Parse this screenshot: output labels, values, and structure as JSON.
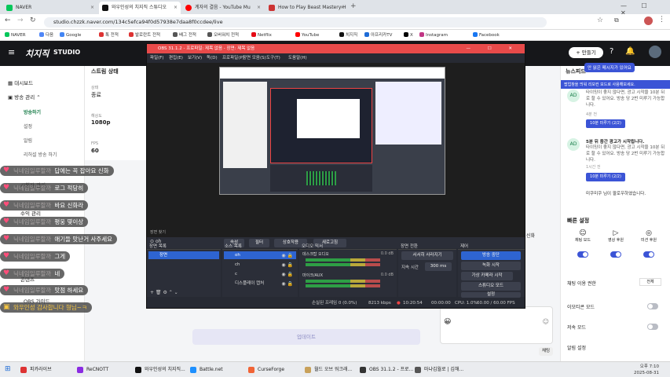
{
  "browser": {
    "tabs": [
      {
        "label": "NAVER",
        "color": "#03c75a"
      },
      {
        "label": "와우인성의 치지직 스튜디오",
        "color": "#111111"
      },
      {
        "label": "계자의 결음 - YouTube Mu",
        "color": "#ff0000"
      },
      {
        "label": "How to Play Beast Mastery H",
        "color": "#c33"
      }
    ],
    "url": "studio.chzzk.naver.com/134c5efca94f0d57938e7daa8f0ccdee/live",
    "bookmarks": [
      "NAVER",
      "다음",
      "Google",
      "톡 전적",
      "발로란트 전적",
      "배그 전적",
      "오버워치 전적",
      "Netflix",
      "YouTube",
      "치지직",
      "아프리카TV",
      "X",
      "Instagram",
      "Facebook"
    ]
  },
  "studio": {
    "brand": "치지직",
    "brand_sub": "STUDIO",
    "make_button": "+ 만들기",
    "stream_status_label": "스트림 상태",
    "stats": [
      {
        "label": "상태",
        "value": "종료"
      },
      {
        "label": "해상도",
        "value": "1080p"
      },
      {
        "label": "FPS",
        "value": "60"
      }
    ]
  },
  "sidebar": {
    "dashboard": "대시보드",
    "broadcast_manage": "방송 관리",
    "sub": [
      "방송하기",
      "설정",
      "알림",
      "리허설 방송 하기"
    ],
    "other": [
      "시청자 관리",
      "수익 관리",
      "콘텐츠",
      "OBS 가이드"
    ]
  },
  "chat_overlay": [
    {
      "nick": "닉네임일루할까",
      "msg": "답에는 꼭 잡아요 신화"
    },
    {
      "nick": "닉네임일루할까",
      "msg": "로그 적당히"
    },
    {
      "nick": "닉네임일루할까",
      "msg": "바요 신화라"
    },
    {
      "nick": "닉네임일루할까",
      "msg": "평웅 몇이상"
    },
    {
      "nick": "닉네임일루할까",
      "msg": "애기들 맛난거 사주세요"
    },
    {
      "nick": "닉네임일루할까",
      "msg": "그게"
    },
    {
      "nick": "닉네임일루할까",
      "msg": "네"
    },
    {
      "nick": "닉네임일루할까",
      "msg": "맛점 하세요"
    }
  ],
  "chat_overlay_last": "와우인성 감사합니다 형님~ㅋ",
  "obs": {
    "title": "OBS 31.1.2 - 프로파일: 제목 없음 - 장면: 제목 없음",
    "menu": [
      "파일(F)",
      "편집(E)",
      "보기(V)",
      "독(D)",
      "프로파일(P)",
      "장면 모음(S)",
      "도구(T)",
      "도움말(H)"
    ],
    "preview_caption": "장면 찾기",
    "source_name": "oh",
    "toolbar": [
      "속성",
      "필터",
      "상호작용",
      "새로고침"
    ],
    "docks": {
      "scenes": {
        "title": "장면 목록",
        "items": [
          "장면"
        ]
      },
      "sources": {
        "title": "소스 목록",
        "items": [
          "oh",
          "ch",
          "c",
          "디스플레이 캡처"
        ]
      },
      "mixer": {
        "title": "오디오 믹서",
        "tracks": [
          "데스크탑 오디오",
          "마이크/AUX"
        ],
        "db": "0.0 dB"
      },
      "transitions": {
        "title": "장면 전환",
        "type": "서서히 사라지기",
        "duration_label": "지속 시간",
        "duration": "300 ms"
      },
      "controls": {
        "title": "제어",
        "buttons": [
          "방송 중단",
          "녹화 시작",
          "가상 카메라 시작",
          "스튜디오 모드",
          "설정"
        ]
      }
    },
    "status": {
      "dropped": "손실된 프레임 0 (0.0%)",
      "bitrate": "8213 kbps",
      "live_time": "10:20:54",
      "rec_time": "00:00:00",
      "cpu": "CPU: 1.0%",
      "fps": "60.00 / 60.00 FPS"
    }
  },
  "right_panel": {
    "news_title": "뉴스피드",
    "tooltip": "안 읽은 메시지가 있어요",
    "notice": "팝업창을 띄워 리모컨 모드로 사용해보세요.",
    "msgs": [
      {
        "title": "타이밍이 좋지 않다면, 광고 시작을 10분 뒤로 할 수 있어요. 방송 당 2번 미루기 가능합니다.",
        "time": "4분 전",
        "btn": "10분 미루기 (2/2)"
      },
      {
        "title": "5분 뒤 중간 광고가 시작됩니다.",
        "sub": "타이밍이 좋지 않다면, 광고 시작을 10분 뒤로 할 수 있어요. 방송 당 2번 미루기 가능합니다.",
        "time": "1시간 전",
        "btn": "10분 미루기 (2/2)"
      }
    ],
    "follow_msg": "미쿠미쿠 님이 팔로우하였습니다.",
    "quick_title": "빠른 설정",
    "quick": [
      "채팅 모드",
      "영상 후원",
      "미션 후원"
    ],
    "settings": [
      {
        "label": "채팅 이용 권한",
        "value": "전체"
      },
      {
        "label": "이모티콘 모드",
        "value": ""
      },
      {
        "label": "저속 모드",
        "value": ""
      },
      {
        "label": "알림 설정",
        "value": ""
      }
    ],
    "chat_send": "채팅"
  },
  "misc": {
    "update_btn": "업데이트",
    "page_right_note": "신화",
    "time": "오후 7:10",
    "date": "2025-08-31"
  },
  "taskbar": [
    "피카라이브",
    "ReCNOTT",
    "와우인성의 치지직...",
    "Battle.net",
    "CurseForge",
    "월드 오브 워크래...",
    "OBS 31.1.2 - 프로...",
    "마냐김월로 | 김해..."
  ]
}
